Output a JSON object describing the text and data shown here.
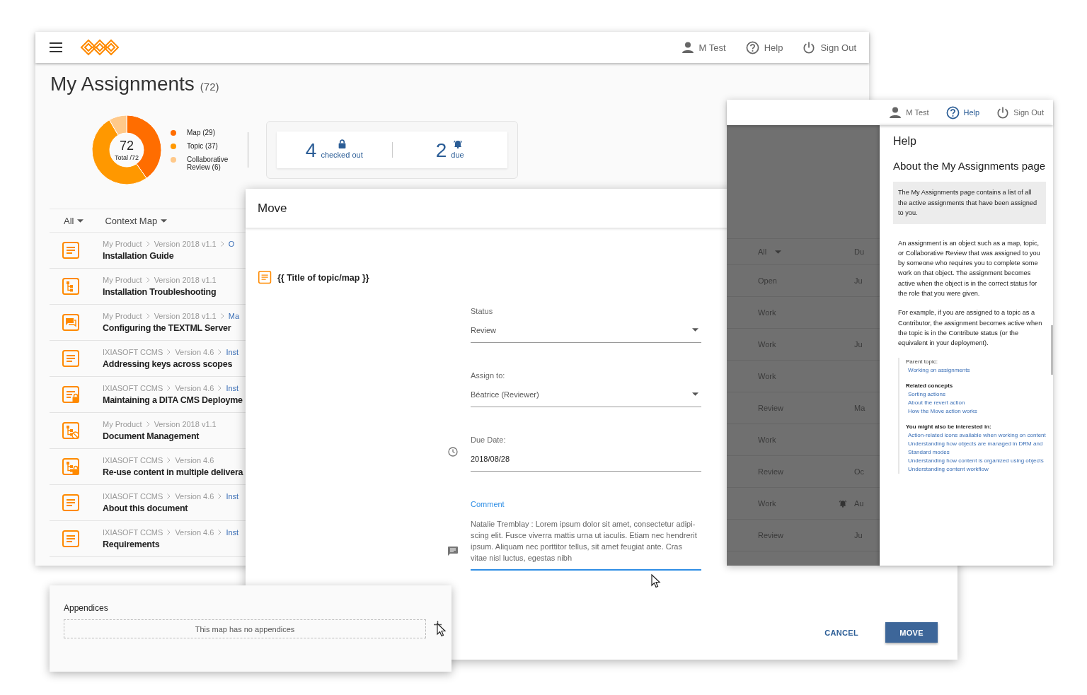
{
  "main_window": {
    "header": {
      "items": [
        {
          "kind": "user",
          "label": "M Test",
          "selected": false
        },
        {
          "kind": "help",
          "label": "Help",
          "selected": false
        },
        {
          "kind": "signout",
          "label": "Sign Out",
          "selected": false
        }
      ]
    },
    "title": "My Assignments",
    "count": "(72)",
    "donut": {
      "total": "72",
      "caption": "Total /72"
    },
    "chart_data": {
      "type": "donut",
      "categories": [
        "Map (29)",
        "Topic (37)",
        "Collaborative Review (6)"
      ],
      "series": [
        {
          "values": [
            29,
            37,
            6
          ]
        }
      ]
    },
    "legend": [
      {
        "color": "#ff6d00"
      },
      {
        "color": "#ff9800"
      },
      {
        "color": "#ffc98a"
      }
    ],
    "stats": [
      {
        "kind": "lock",
        "number": "4",
        "label": "checked out"
      },
      {
        "kind": "bell",
        "number": "2",
        "label": "due"
      }
    ],
    "filters": [
      {
        "label": "All"
      },
      {
        "label": "Context Map"
      }
    ],
    "assignments": [
      {
        "kind": "topic",
        "crumbs": [
          "My Product",
          "Version 2018 v1.1",
          "O"
        ],
        "title": "Installation Guide"
      },
      {
        "kind": "map",
        "crumbs": [
          "My Product",
          "Version 2018 v1.1"
        ],
        "title": "Installation Troubleshooting"
      },
      {
        "kind": "review",
        "crumbs": [
          "My Product",
          "Version 2018 v1.1",
          "Ma"
        ],
        "title": "Configuring the TEXTML Server"
      },
      {
        "kind": "topic",
        "crumbs": [
          "IXIASOFT CCMS",
          "Version 4.6",
          "Inst"
        ],
        "title": "Addressing keys across scopes"
      },
      {
        "kind": "topic-locked",
        "crumbs": [
          "IXIASOFT CCMS",
          "Version 4.6",
          "Inst"
        ],
        "title": "Maintaining a DITA CMS Deployme"
      },
      {
        "kind": "map-blocked",
        "crumbs": [
          "My Product",
          "Version 2018 v1.1"
        ],
        "title": "Document Management"
      },
      {
        "kind": "map-locked",
        "crumbs": [
          "IXIASOFT CCMS",
          "Version 4.6"
        ],
        "title": "Re-use content in multiple delivera"
      },
      {
        "kind": "topic",
        "crumbs": [
          "IXIASOFT CCMS",
          "Version 4.6",
          "Inst"
        ],
        "title": "About this document"
      },
      {
        "kind": "topic",
        "crumbs": [
          "IXIASOFT CCMS",
          "Version 4.6",
          "Inst"
        ],
        "title": "Requirements"
      }
    ]
  },
  "move_dialog": {
    "title": "Move",
    "item": {
      "kind": "topic",
      "title": "{{ Title of topic/map }}"
    },
    "fields": [
      {
        "kind": "select",
        "label": "Status",
        "value": "Review",
        "focused": false
      },
      {
        "kind": "select",
        "label": "Assign to:",
        "value": "Béatrice (Reviewer)",
        "focused": false
      },
      {
        "kind": "date",
        "label": "Due Date:",
        "value": "2018/08/28",
        "focused": false
      },
      {
        "kind": "comment",
        "label": "Comment",
        "value": "Natalie Tremblay  : Lorem ipsum dolor sit amet, consectetur adipi-scing elit. Fusce viverra mattis urna ut iaculis. Etiam nec hendrerit ipsum. Aliquam nec porttitor tellus, sit amet feugiat ante. Cras vitae nisl luctus, egestas nibh",
        "focused": true
      }
    ],
    "buttons": [
      {
        "kind": "text",
        "label": "CANCEL"
      },
      {
        "kind": "raised",
        "label": "MOVE"
      }
    ]
  },
  "right_window": {
    "header": {
      "items": [
        {
          "kind": "user",
          "label": "M Test",
          "selected": false
        },
        {
          "kind": "help",
          "label": "Help",
          "selected": true
        },
        {
          "kind": "signout",
          "label": "Sign Out",
          "selected": false
        }
      ]
    },
    "list": {
      "filter": "All",
      "column_2": "Du",
      "rows": [
        {
          "status": "Open",
          "alert": false,
          "column_2": "Ju"
        },
        {
          "status": "Work",
          "alert": false
        },
        {
          "status": "Work",
          "alert": false,
          "column_2": "Ju"
        },
        {
          "status": "Work",
          "alert": false
        },
        {
          "status": "Review",
          "alert": false,
          "column_2": "Ma"
        },
        {
          "status": "Work",
          "alert": false
        },
        {
          "status": "Review",
          "alert": false,
          "column_2": "Oc"
        },
        {
          "status": "Work",
          "alert": true,
          "column_2": "Au"
        },
        {
          "status": "Review",
          "alert": false,
          "column_2": "Ju"
        }
      ]
    },
    "help": {
      "title": "Help",
      "heading": "About the My Assignments page",
      "shortdesc": "The My Assignments page contains a list of all the active assignments that have been assigned to you.",
      "paragraphs": [
        "An assignment is an object such as a map, topic, or Collaborative Review that was assigned to you by someone who requires you to complete some work on that object. The assignment becomes active when the object is in the correct status for the role that you were given.",
        "For example, if you are assigned to a topic as a Contributor, the assignment becomes active when the topic is in the Contribute status (or the equivalent in your deployment)."
      ],
      "parent_label": "Parent topic:",
      "parent_link": "Working on assignments",
      "sections": [
        {
          "title": "Related concepts",
          "links": [
            "Sorting actions",
            "About the revert action",
            "How the Move action works"
          ]
        },
        {
          "title": "You might also be interested in:",
          "links": [
            "Action-related icons available when working on content",
            "Understanding how objects are managed in DRM and Standard modes",
            "Understanding how content is organized using objects",
            "Understanding content workflow"
          ]
        }
      ]
    }
  },
  "appendices": {
    "title": "Appendices",
    "empty_text": "This map has no appendices"
  }
}
